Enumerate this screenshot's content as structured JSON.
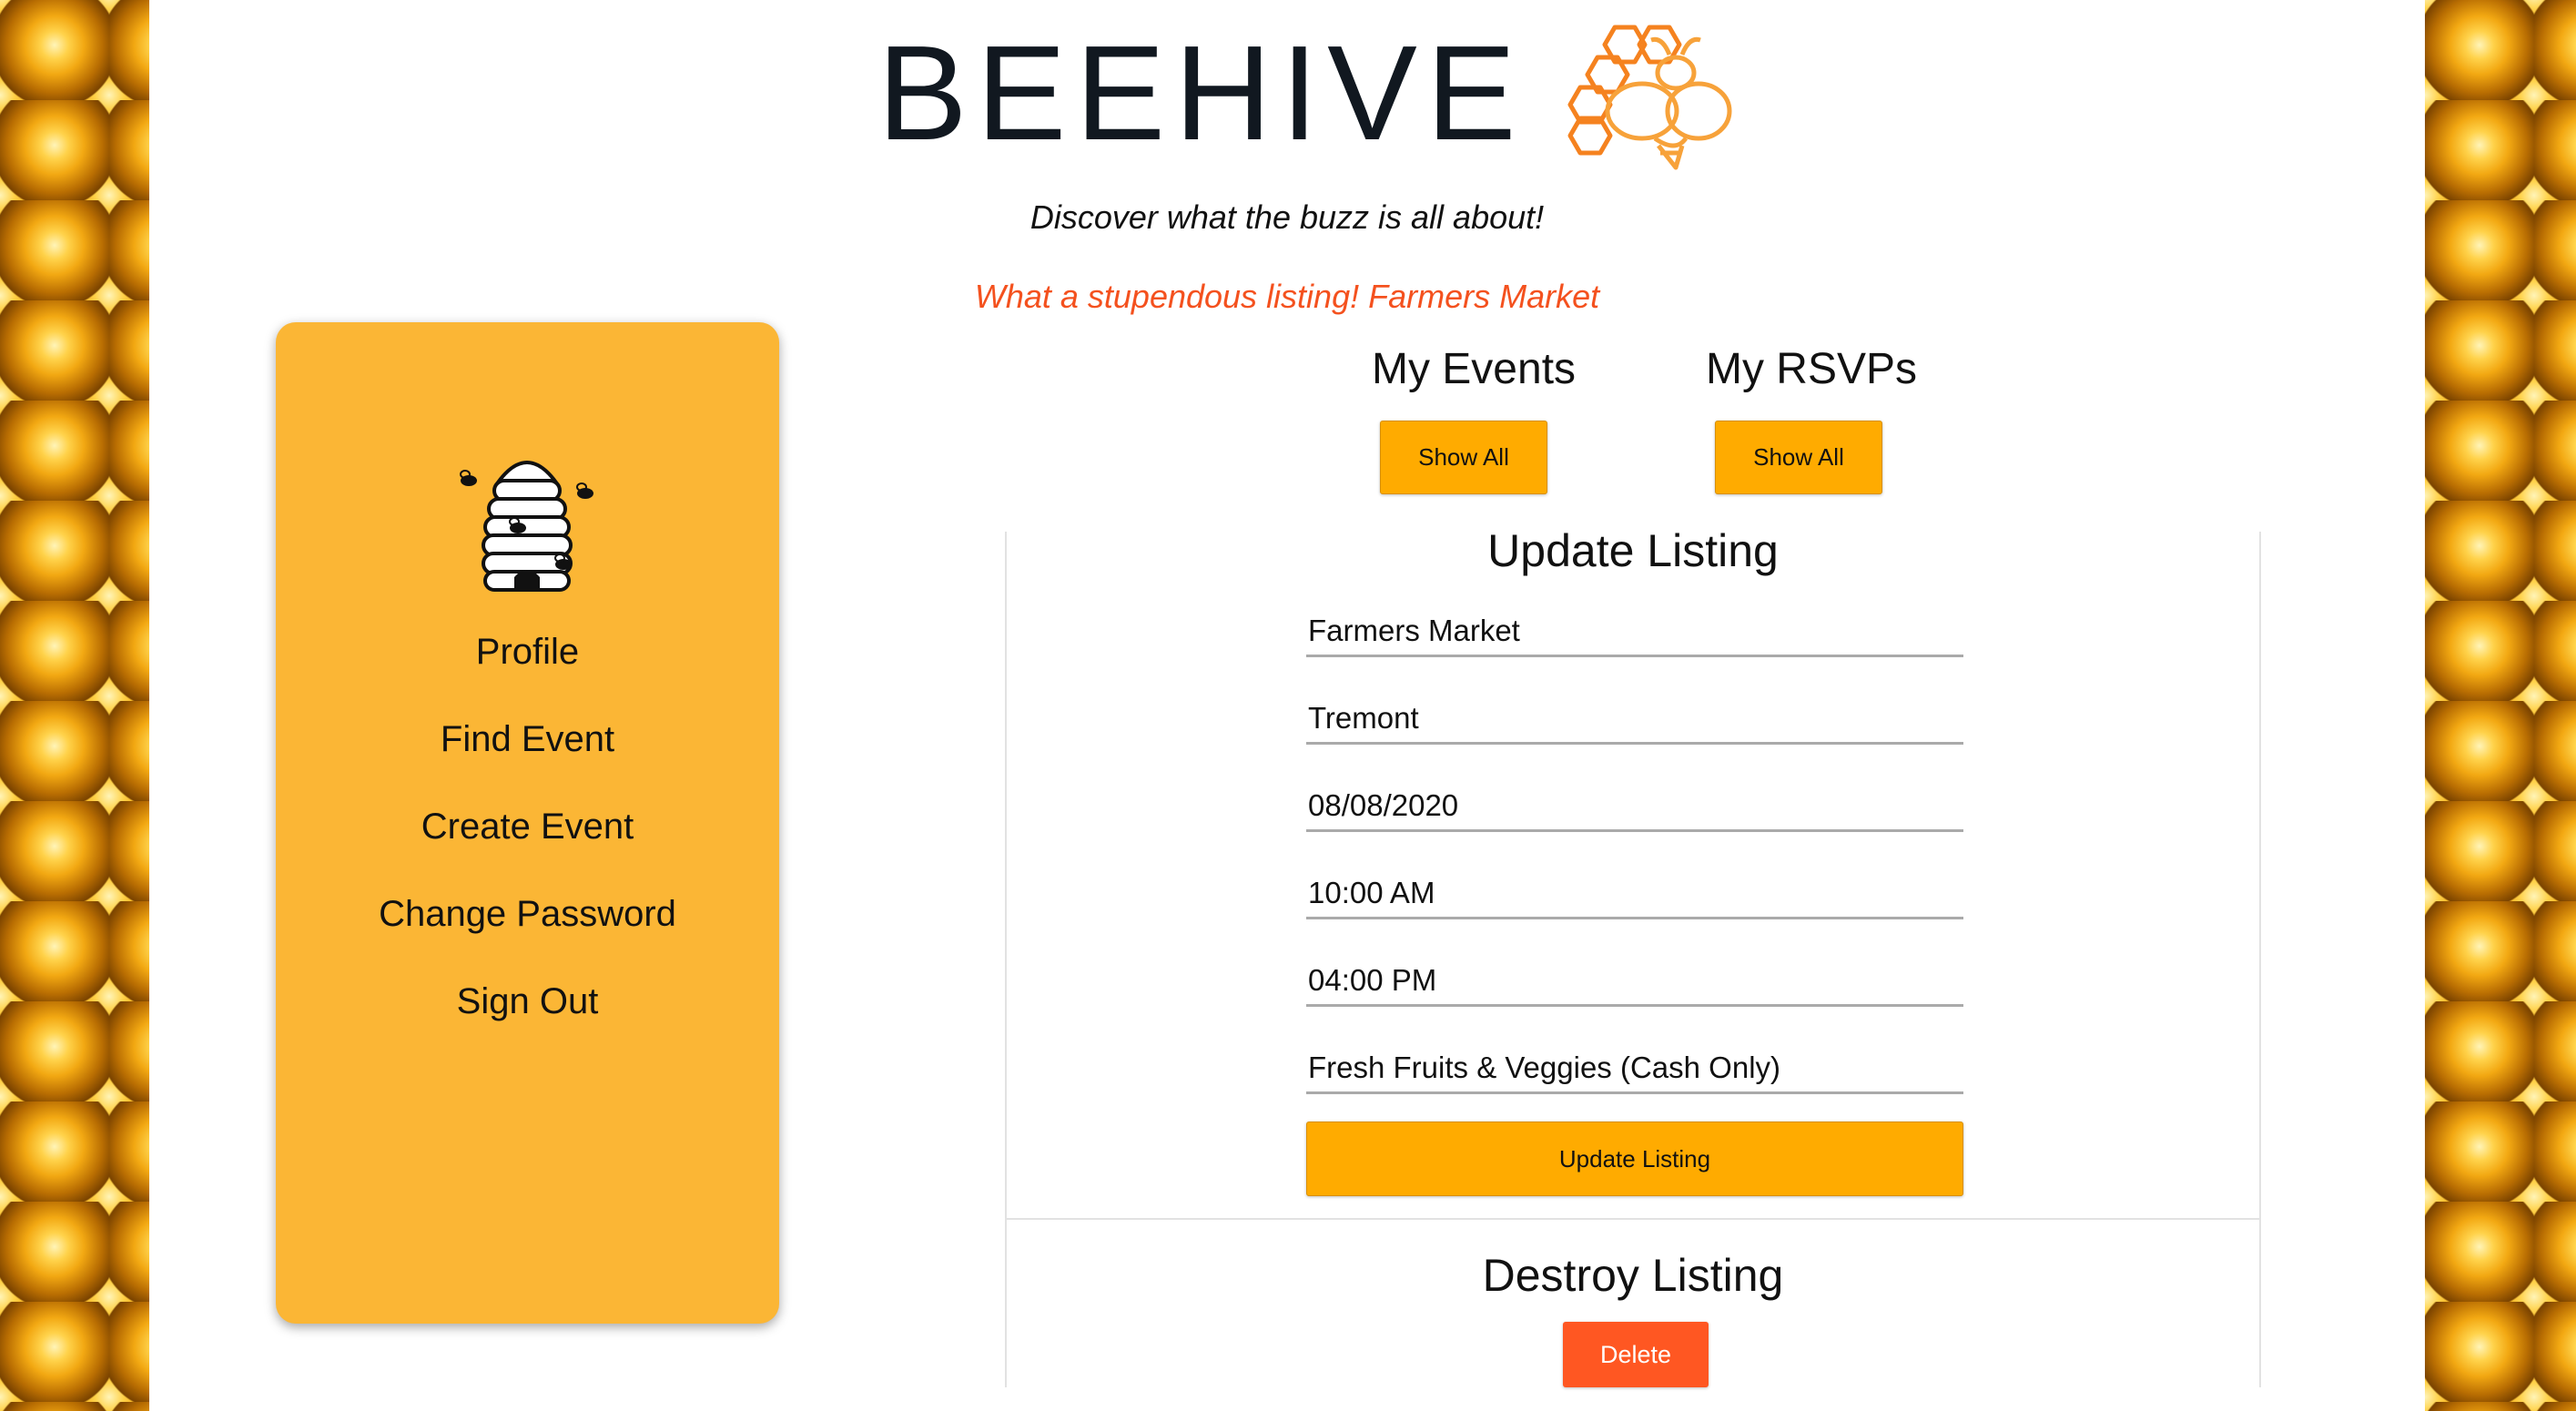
{
  "header": {
    "brand_title": "BEEHIVE",
    "tagline": "Discover what the buzz is all about!",
    "flash_message": "What a stupendous listing! Farmers Market"
  },
  "sidebar": {
    "items": [
      {
        "label": "Profile"
      },
      {
        "label": "Find Event"
      },
      {
        "label": "Create Event"
      },
      {
        "label": "Change Password"
      },
      {
        "label": "Sign Out"
      }
    ]
  },
  "events": {
    "my_events_heading": "My Events",
    "my_events_button": "Show All",
    "my_rsvps_heading": "My RSVPs",
    "my_rsvps_button": "Show All"
  },
  "update_form": {
    "title": "Update Listing",
    "name": "Farmers Market",
    "location": "Tremont",
    "date": "08/08/2020",
    "start_time": "10:00 AM",
    "end_time": "04:00 PM",
    "description": "Fresh Fruits & Veggies (Cash Only)",
    "submit_label": "Update Listing"
  },
  "destroy_form": {
    "title": "Destroy Listing",
    "delete_label": "Delete"
  },
  "colors": {
    "accent": "#ffab00",
    "sidebar": "#fbb635",
    "danger": "#ff5722",
    "flash": "#f4511e",
    "logo": "#f5821f"
  }
}
